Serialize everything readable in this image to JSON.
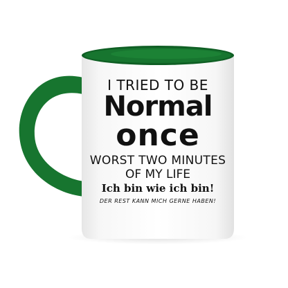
{
  "product": {
    "type": "two-tone mug",
    "colors": {
      "body": "#ffffff",
      "inner": "#17752f",
      "handle": "#17752f",
      "background": "#ffffff"
    }
  },
  "print": {
    "line1": "I TRIED TO BE",
    "line2": "Normal",
    "line3": "once",
    "line4": "WORST TWO MINUTES",
    "line5": "OF MY LIFE",
    "line6": "Ich bin wie ich bin!",
    "line7": "DER REST KANN MICH GERNE HABEN!"
  }
}
